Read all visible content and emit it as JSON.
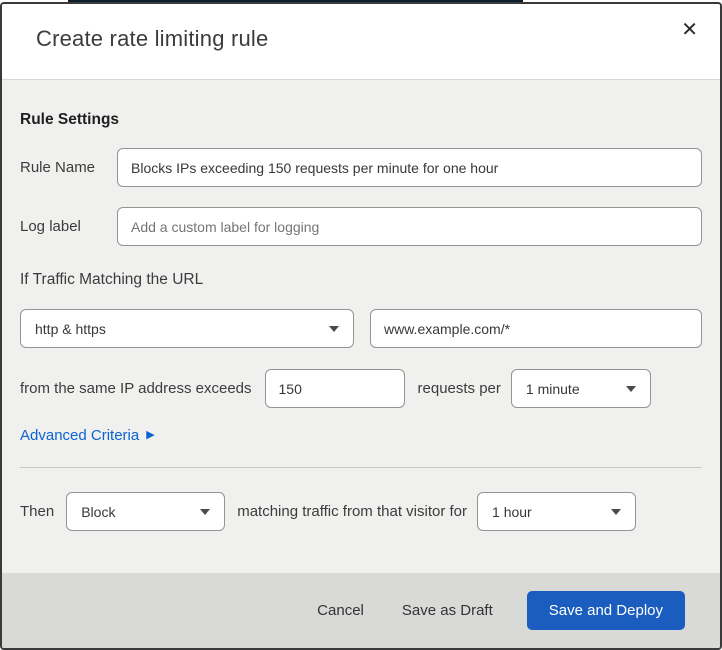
{
  "page": {
    "backdrop_strip_color": "#0c1d2b"
  },
  "modal": {
    "title": "Create rate limiting rule",
    "close_icon": "✕",
    "section_heading": "Rule Settings",
    "fields": {
      "rule_name": {
        "label": "Rule Name",
        "value": "Blocks IPs exceeding 150 requests per minute for one hour"
      },
      "log_label": {
        "label": "Log label",
        "placeholder": "Add a custom label for logging"
      },
      "traffic_match_heading": "If Traffic Matching the URL",
      "scheme_select": {
        "value": "http & https"
      },
      "url_input": {
        "value": "www.example.com/*"
      },
      "threshold_row": {
        "prefix": "from the same IP address exceeds",
        "count_value": "150",
        "middle": "requests per",
        "period_value": "1 minute"
      },
      "advanced_criteria": {
        "label": "Advanced Criteria",
        "arrow": "▶"
      },
      "then_row": {
        "prefix": "Then",
        "action_value": "Block",
        "middle": "matching traffic from that visitor for",
        "duration_value": "1 hour"
      }
    },
    "footer": {
      "cancel_label": "Cancel",
      "save_draft_label": "Save as Draft",
      "save_deploy_label": "Save and Deploy"
    },
    "colors": {
      "primary_button": "#1a5dbe",
      "link": "#0b62d0",
      "body_background": "#f0f0ef",
      "footer_background": "#d9d9d8"
    }
  }
}
